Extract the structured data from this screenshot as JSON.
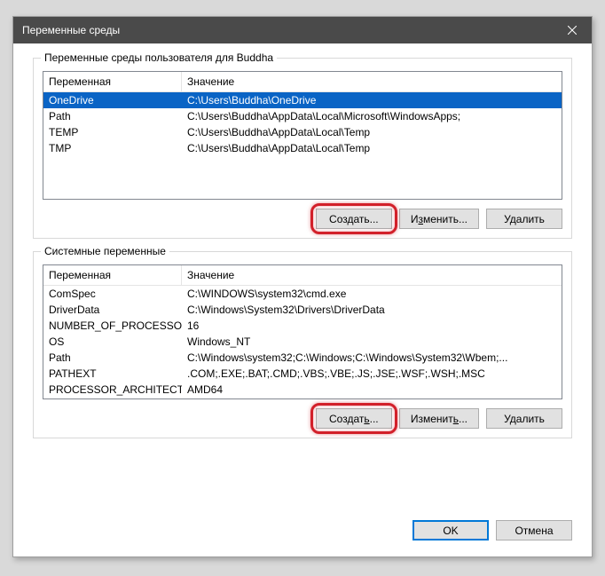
{
  "window": {
    "title": "Переменные среды"
  },
  "userGroup": {
    "label": "Переменные среды пользователя для Buddha",
    "columns": {
      "name": "Переменная",
      "value": "Значение"
    },
    "rows": [
      {
        "name": "OneDrive",
        "value": "C:\\Users\\Buddha\\OneDrive",
        "selected": true
      },
      {
        "name": "Path",
        "value": "C:\\Users\\Buddha\\AppData\\Local\\Microsoft\\WindowsApps;"
      },
      {
        "name": "TEMP",
        "value": "C:\\Users\\Buddha\\AppData\\Local\\Temp"
      },
      {
        "name": "TMP",
        "value": "C:\\Users\\Buddha\\AppData\\Local\\Temp"
      }
    ],
    "buttons": {
      "create": "Создать...",
      "edit": "Изменить...",
      "delete": "Удалить"
    }
  },
  "systemGroup": {
    "label": "Системные переменные",
    "columns": {
      "name": "Переменная",
      "value": "Значение"
    },
    "rows": [
      {
        "name": "ComSpec",
        "value": "C:\\WINDOWS\\system32\\cmd.exe"
      },
      {
        "name": "DriverData",
        "value": "C:\\Windows\\System32\\Drivers\\DriverData"
      },
      {
        "name": "NUMBER_OF_PROCESSORS",
        "value": "16"
      },
      {
        "name": "OS",
        "value": "Windows_NT"
      },
      {
        "name": "Path",
        "value": "C:\\Windows\\system32;C:\\Windows;C:\\Windows\\System32\\Wbem;..."
      },
      {
        "name": "PATHEXT",
        "value": ".COM;.EXE;.BAT;.CMD;.VBS;.VBE;.JS;.JSE;.WSF;.WSH;.MSC"
      },
      {
        "name": "PROCESSOR_ARCHITECTURE",
        "value": "AMD64"
      }
    ],
    "buttons": {
      "create": "Создать...",
      "edit": "Изменить...",
      "delete": "Удалить"
    }
  },
  "dialogButtons": {
    "ok": "OK",
    "cancel": "Отмена"
  }
}
